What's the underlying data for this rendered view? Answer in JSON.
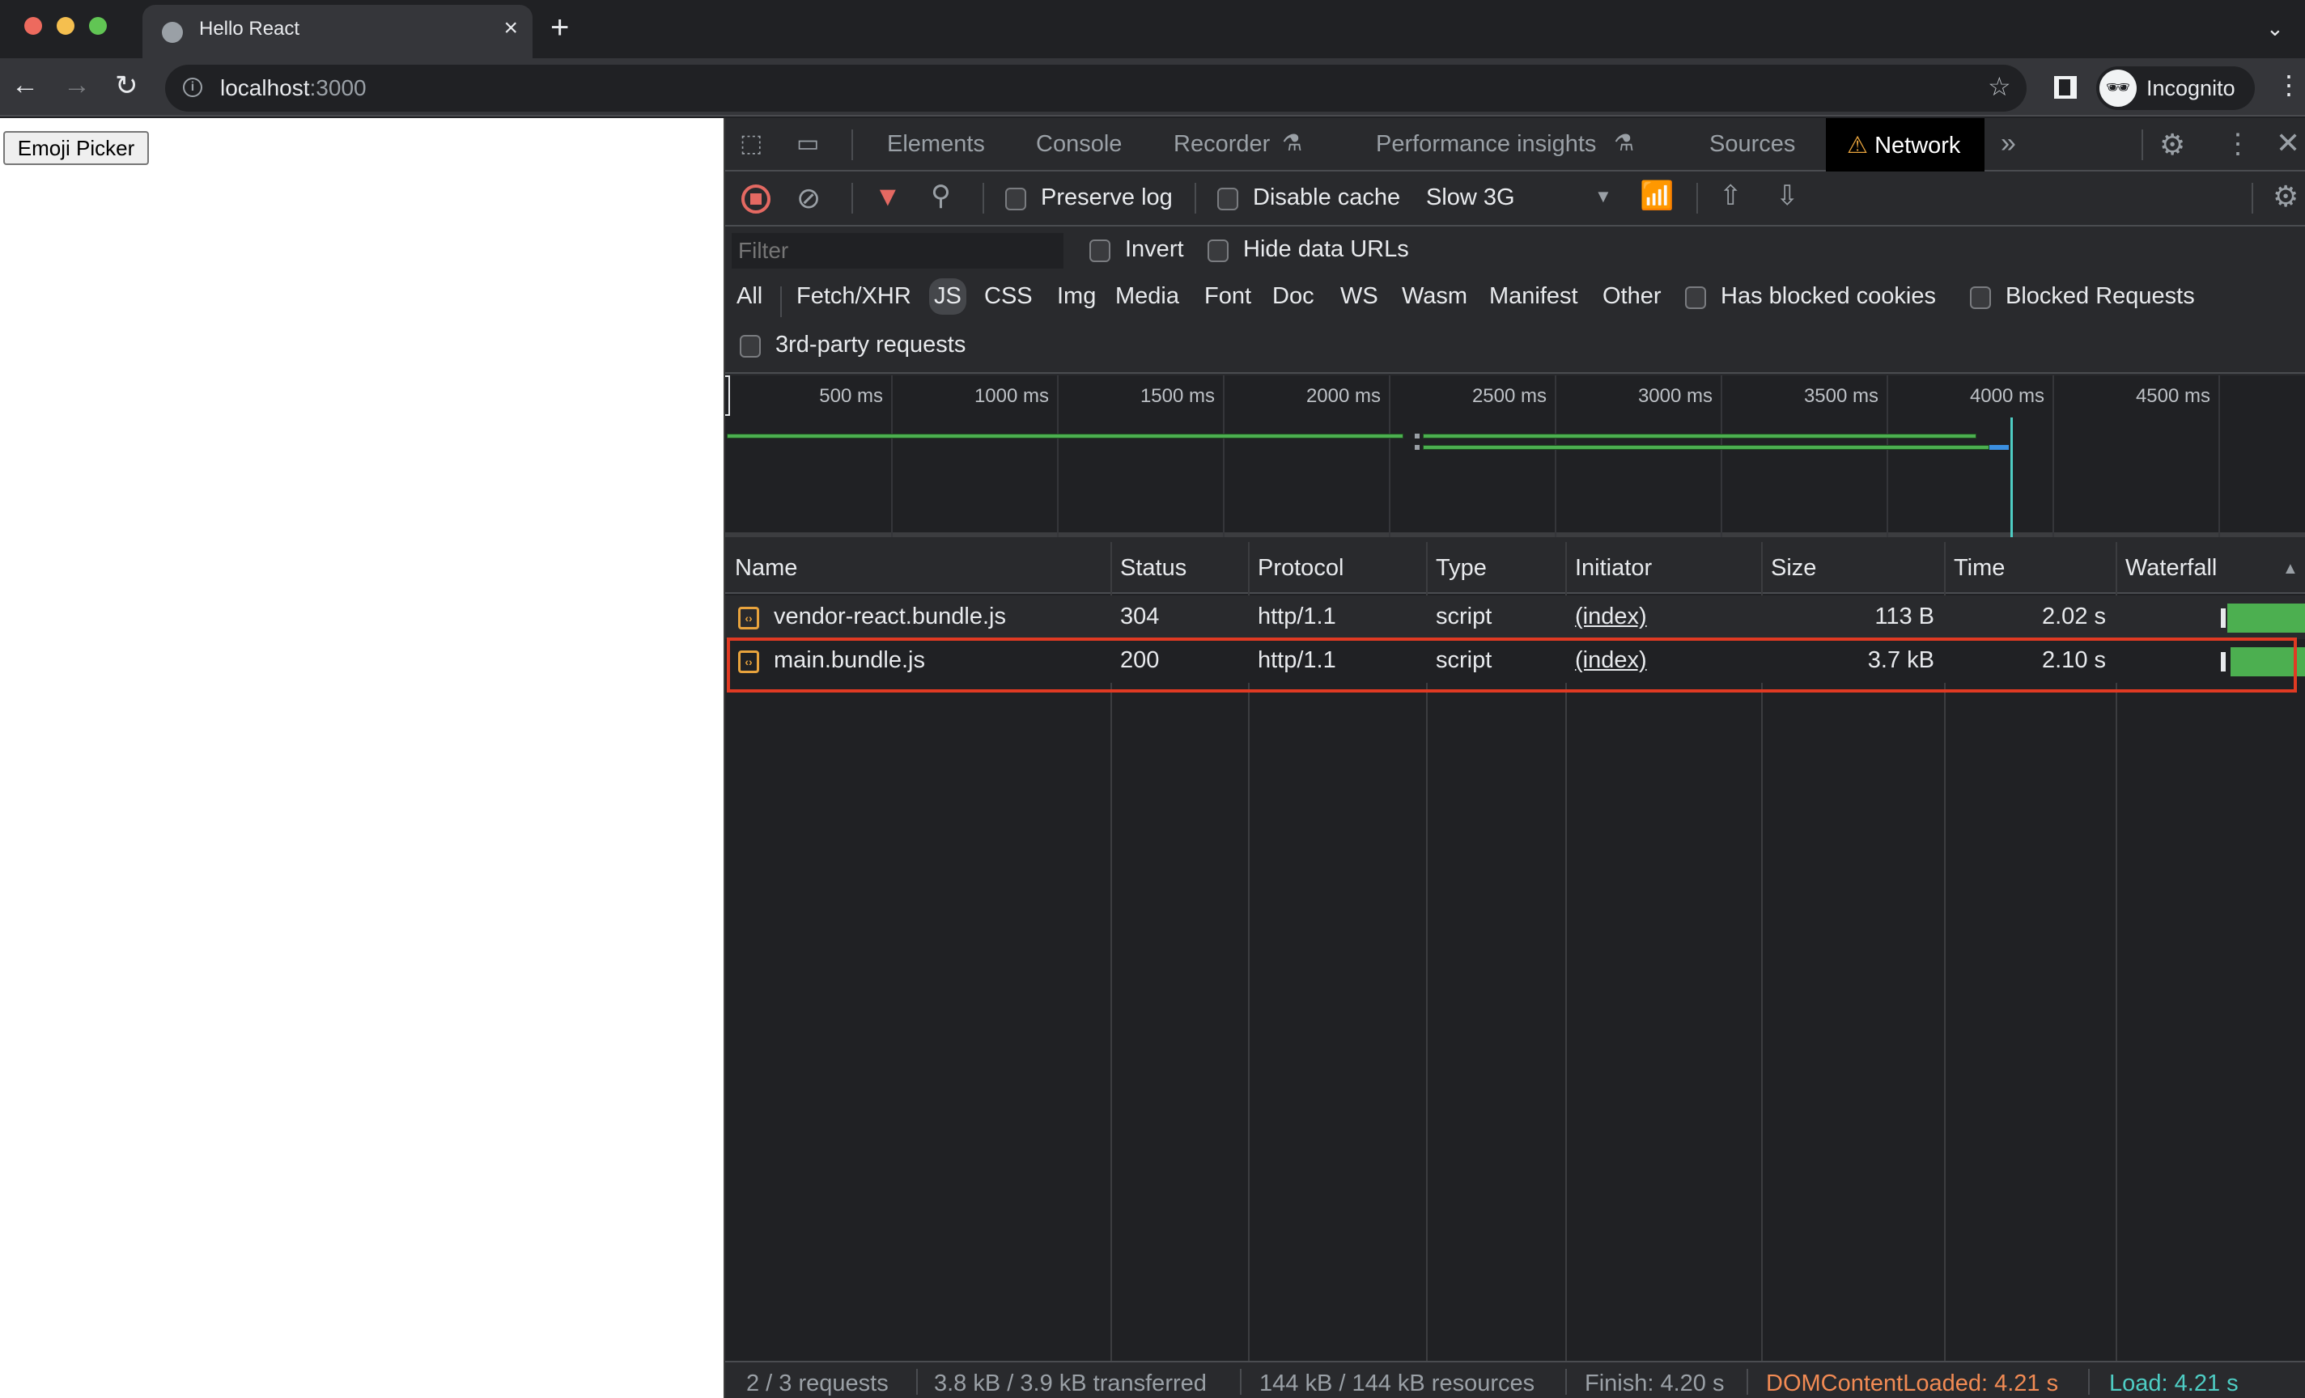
{
  "browser": {
    "tab_title": "Hello React",
    "url_host": "localhost",
    "url_port": ":3000",
    "profile_label": "Incognito",
    "traffic_colors": [
      "#ed6a5e",
      "#f5bf4f",
      "#61c554"
    ]
  },
  "page": {
    "emoji_button_label": "Emoji Picker"
  },
  "devtools": {
    "tabs": [
      {
        "label": "Elements"
      },
      {
        "label": "Console"
      },
      {
        "label": "Recorder"
      },
      {
        "label": "Performance insights"
      },
      {
        "label": "Sources"
      },
      {
        "label": "Network",
        "active": true
      }
    ],
    "toolbar": {
      "preserve_log": "Preserve log",
      "disable_cache": "Disable cache",
      "throttling": "Slow 3G"
    },
    "filter": {
      "placeholder": "Filter",
      "invert": "Invert",
      "hide_data_urls": "Hide data URLs",
      "types": [
        "All",
        "Fetch/XHR",
        "JS",
        "CSS",
        "Img",
        "Media",
        "Font",
        "Doc",
        "WS",
        "Wasm",
        "Manifest",
        "Other"
      ],
      "active_type": "JS",
      "has_blocked_cookies": "Has blocked cookies",
      "blocked_requests": "Blocked Requests",
      "third_party": "3rd-party requests"
    },
    "overview": {
      "ticks": [
        "500 ms",
        "1000 ms",
        "1500 ms",
        "2000 ms",
        "2500 ms",
        "3000 ms",
        "3500 ms",
        "4000 ms",
        "4500 ms"
      ],
      "load_marker_ms": 4210
    },
    "table": {
      "columns": [
        "Name",
        "Status",
        "Protocol",
        "Type",
        "Initiator",
        "Size",
        "Time",
        "Waterfall"
      ],
      "rows": [
        {
          "name": "vendor-react.bundle.js",
          "status": "304",
          "protocol": "http/1.1",
          "type": "script",
          "initiator": "(index)",
          "size": "113 B",
          "time": "2.02 s"
        },
        {
          "name": "main.bundle.js",
          "status": "200",
          "protocol": "http/1.1",
          "type": "script",
          "initiator": "(index)",
          "size": "3.7 kB",
          "time": "2.10 s",
          "highlighted": true
        }
      ]
    },
    "status": {
      "requests": "2 / 3 requests",
      "transferred": "3.8 kB / 3.9 kB transferred",
      "resources": "144 kB / 144 kB resources",
      "finish": "Finish: 4.20 s",
      "dom_content_loaded": "DOMContentLoaded: 4.21 s",
      "load": "Load: 4.21 s",
      "dcl_color": "#f28b54",
      "load_color": "#4ecdc4"
    }
  }
}
